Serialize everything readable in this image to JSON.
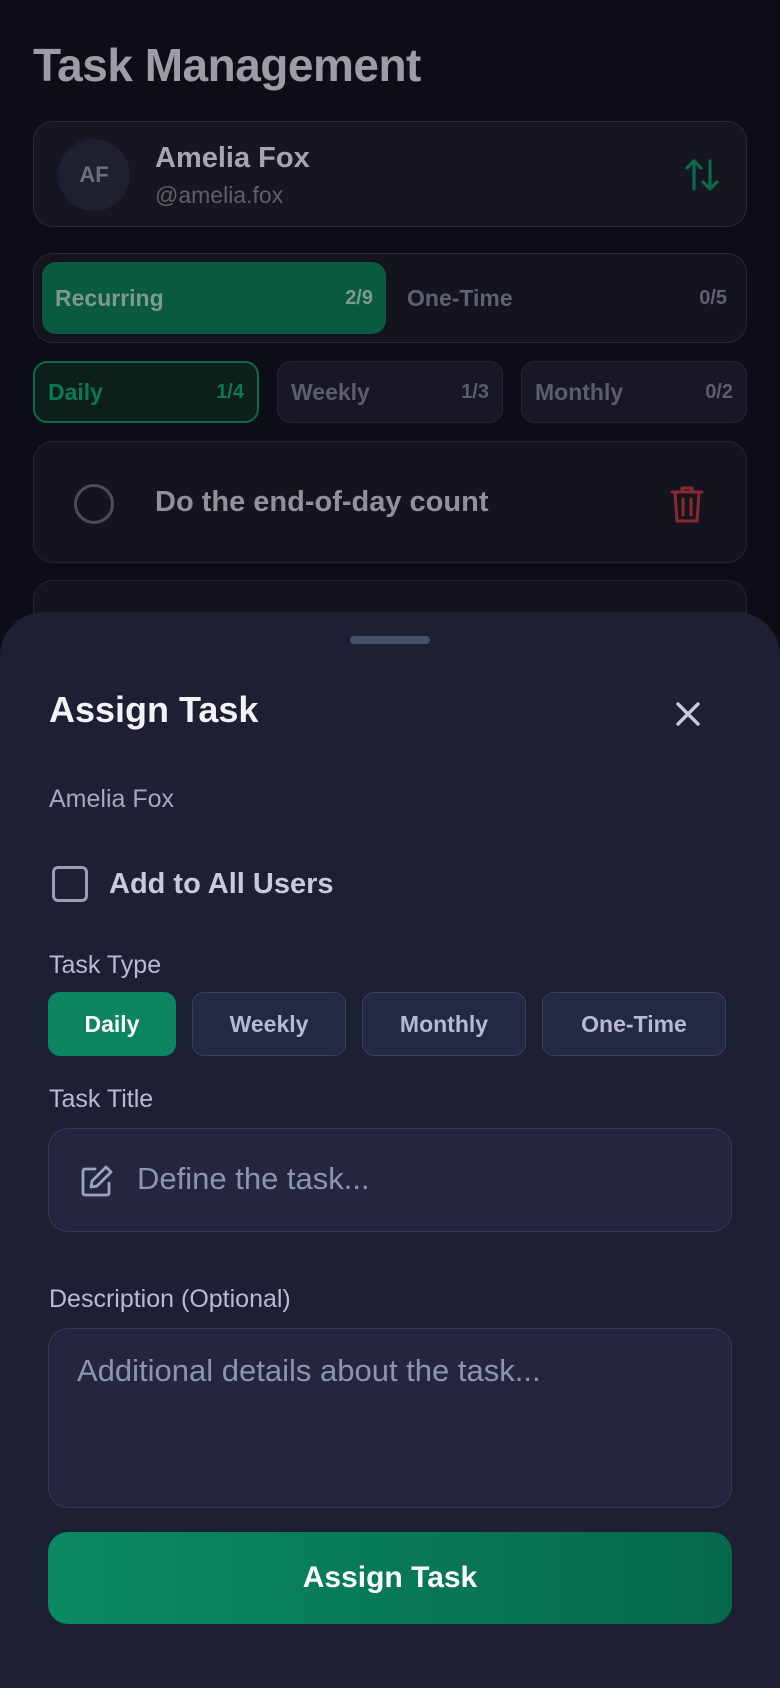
{
  "background": {
    "page_title": "Task Management",
    "user": {
      "initials": "AF",
      "name": "Amelia Fox",
      "handle": "@amelia.fox"
    },
    "category_tabs": [
      {
        "label": "Recurring",
        "count": "2/9",
        "active": true
      },
      {
        "label": "One-Time",
        "count": "0/5",
        "active": false
      }
    ],
    "sub_tabs": [
      {
        "label": "Daily",
        "count": "1/4",
        "active": true
      },
      {
        "label": "Weekly",
        "count": "1/3",
        "active": false
      },
      {
        "label": "Monthly",
        "count": "0/2",
        "active": false
      }
    ],
    "tasks": [
      {
        "title": "Do the end-of-day count",
        "done": false
      }
    ]
  },
  "sheet": {
    "title": "Assign Task",
    "user_name": "Amelia Fox",
    "add_all_label": "Add to All Users",
    "add_all_checked": false,
    "task_type_label": "Task Type",
    "task_types": [
      {
        "label": "Daily",
        "selected": true
      },
      {
        "label": "Weekly",
        "selected": false
      },
      {
        "label": "Monthly",
        "selected": false
      },
      {
        "label": "One-Time",
        "selected": false
      }
    ],
    "task_title_label": "Task Title",
    "task_title_value": "",
    "task_title_placeholder": "Define the task...",
    "description_label": "Description (Optional)",
    "description_value": "",
    "description_placeholder": "Additional details about the task...",
    "submit_label": "Assign Task"
  },
  "colors": {
    "accent": "#0a8560",
    "sheet_bg": "#1d1f33",
    "page_bg": "#0c0d17",
    "danger": "#8a2a30"
  },
  "icons": [
    "sort-arrows-icon",
    "radio-circle-icon",
    "trash-icon",
    "close-icon",
    "checkbox-icon",
    "edit-icon"
  ]
}
